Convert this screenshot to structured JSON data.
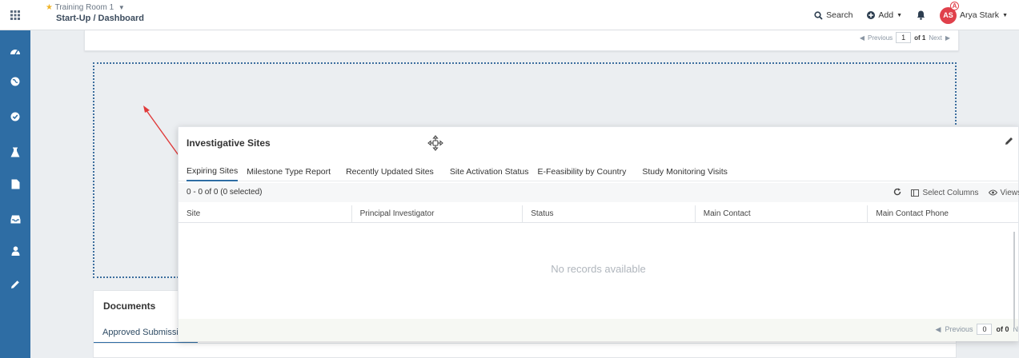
{
  "header": {
    "room": "Training Room 1",
    "breadcrumb": "Start-Up / Dashboard",
    "search_label": "Search",
    "add_label": "Add",
    "user_initials": "AS",
    "user_badge": "A",
    "user_name": "Arya Stark"
  },
  "top_panel": {
    "pager": {
      "prev": "Previous",
      "page": "1",
      "of": "of 1",
      "next": "Next"
    }
  },
  "widget": {
    "title": "Investigative Sites",
    "tabs": [
      "Expiring Sites",
      "Milestone Type Report",
      "Recently Updated Sites",
      "Site Activation Status",
      "E-Feasibility by Country",
      "Study Monitoring Visits"
    ],
    "selection": "0 - 0 of 0 (0 selected)",
    "select_columns": "Select Columns",
    "views": "Views",
    "columns": [
      "Site",
      "Principal Investigator",
      "Status",
      "Main Contact",
      "Main Contact Phone"
    ],
    "empty_text": "No records available",
    "pager": {
      "prev": "Previous",
      "page": "0",
      "of": "of 0",
      "next": "N"
    }
  },
  "documents": {
    "title": "Documents",
    "tab": "Approved Submissio"
  },
  "colors": {
    "nav": "#2e6da4",
    "accent": "#2e6da4",
    "avatar": "#e0404b",
    "arrow": "#e03a3a"
  }
}
